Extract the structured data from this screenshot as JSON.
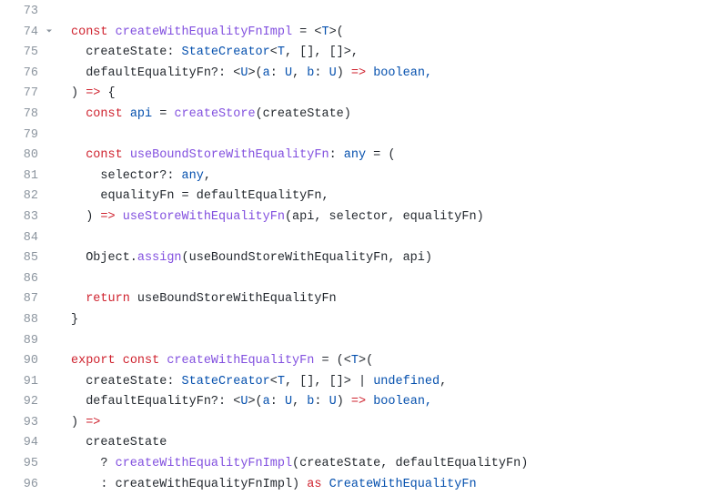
{
  "lines": [
    {
      "num": "73",
      "collapsible": false,
      "tokens": []
    },
    {
      "num": "74",
      "collapsible": true,
      "tokens": [
        {
          "t": "const ",
          "c": "tok-kw"
        },
        {
          "t": "createWithEqualityFnImpl",
          "c": "tok-fn"
        },
        {
          "t": " = <",
          "c": "tok-punc"
        },
        {
          "t": "T",
          "c": "tok-type"
        },
        {
          "t": ">(",
          "c": "tok-punc"
        }
      ]
    },
    {
      "num": "75",
      "collapsible": false,
      "tokens": [
        {
          "t": "  createState: ",
          "c": "tok-param"
        },
        {
          "t": "StateCreator",
          "c": "tok-type"
        },
        {
          "t": "<",
          "c": "tok-punc"
        },
        {
          "t": "T",
          "c": "tok-type"
        },
        {
          "t": ", [], []>,",
          "c": "tok-punc"
        }
      ]
    },
    {
      "num": "76",
      "collapsible": false,
      "tokens": [
        {
          "t": "  defaultEqualityFn?: <",
          "c": "tok-param"
        },
        {
          "t": "U",
          "c": "tok-type"
        },
        {
          "t": ">(",
          "c": "tok-punc"
        },
        {
          "t": "a",
          "c": "tok-var"
        },
        {
          "t": ": ",
          "c": "tok-punc"
        },
        {
          "t": "U",
          "c": "tok-type"
        },
        {
          "t": ", ",
          "c": "tok-punc"
        },
        {
          "t": "b",
          "c": "tok-var"
        },
        {
          "t": ": ",
          "c": "tok-punc"
        },
        {
          "t": "U",
          "c": "tok-type"
        },
        {
          "t": ") ",
          "c": "tok-punc"
        },
        {
          "t": "=>",
          "c": "tok-op"
        },
        {
          "t": " boolean,",
          "c": "tok-var"
        }
      ]
    },
    {
      "num": "77",
      "collapsible": false,
      "tokens": [
        {
          "t": ") ",
          "c": "tok-punc"
        },
        {
          "t": "=>",
          "c": "tok-op"
        },
        {
          "t": " {",
          "c": "tok-punc"
        }
      ]
    },
    {
      "num": "78",
      "collapsible": false,
      "tokens": [
        {
          "t": "  ",
          "c": "tok-plain"
        },
        {
          "t": "const ",
          "c": "tok-kw"
        },
        {
          "t": "api",
          "c": "tok-var"
        },
        {
          "t": " = ",
          "c": "tok-punc"
        },
        {
          "t": "createStore",
          "c": "tok-fn"
        },
        {
          "t": "(createState)",
          "c": "tok-punc"
        }
      ]
    },
    {
      "num": "79",
      "collapsible": false,
      "tokens": []
    },
    {
      "num": "80",
      "collapsible": false,
      "tokens": [
        {
          "t": "  ",
          "c": "tok-plain"
        },
        {
          "t": "const ",
          "c": "tok-kw"
        },
        {
          "t": "useBoundStoreWithEqualityFn",
          "c": "tok-fn"
        },
        {
          "t": ": ",
          "c": "tok-punc"
        },
        {
          "t": "any",
          "c": "tok-var"
        },
        {
          "t": " = (",
          "c": "tok-punc"
        }
      ]
    },
    {
      "num": "81",
      "collapsible": false,
      "tokens": [
        {
          "t": "    selector?: ",
          "c": "tok-param"
        },
        {
          "t": "any",
          "c": "tok-var"
        },
        {
          "t": ",",
          "c": "tok-punc"
        }
      ]
    },
    {
      "num": "82",
      "collapsible": false,
      "tokens": [
        {
          "t": "    equalityFn = defaultEqualityFn,",
          "c": "tok-param"
        }
      ]
    },
    {
      "num": "83",
      "collapsible": false,
      "tokens": [
        {
          "t": "  ) ",
          "c": "tok-punc"
        },
        {
          "t": "=>",
          "c": "tok-op"
        },
        {
          "t": " ",
          "c": "tok-punc"
        },
        {
          "t": "useStoreWithEqualityFn",
          "c": "tok-fn"
        },
        {
          "t": "(api, selector, equalityFn)",
          "c": "tok-punc"
        }
      ]
    },
    {
      "num": "84",
      "collapsible": false,
      "tokens": []
    },
    {
      "num": "85",
      "collapsible": false,
      "tokens": [
        {
          "t": "  Object.",
          "c": "tok-plain"
        },
        {
          "t": "assign",
          "c": "tok-fn"
        },
        {
          "t": "(useBoundStoreWithEqualityFn, api)",
          "c": "tok-punc"
        }
      ]
    },
    {
      "num": "86",
      "collapsible": false,
      "tokens": []
    },
    {
      "num": "87",
      "collapsible": false,
      "tokens": [
        {
          "t": "  ",
          "c": "tok-plain"
        },
        {
          "t": "return ",
          "c": "tok-kw"
        },
        {
          "t": "useBoundStoreWithEqualityFn",
          "c": "tok-plain"
        }
      ]
    },
    {
      "num": "88",
      "collapsible": false,
      "tokens": [
        {
          "t": "}",
          "c": "tok-punc"
        }
      ]
    },
    {
      "num": "89",
      "collapsible": false,
      "tokens": []
    },
    {
      "num": "90",
      "collapsible": false,
      "tokens": [
        {
          "t": "export ",
          "c": "tok-kw"
        },
        {
          "t": "const ",
          "c": "tok-kw"
        },
        {
          "t": "createWithEqualityFn",
          "c": "tok-fn"
        },
        {
          "t": " = (<",
          "c": "tok-punc"
        },
        {
          "t": "T",
          "c": "tok-type"
        },
        {
          "t": ">(",
          "c": "tok-punc"
        }
      ]
    },
    {
      "num": "91",
      "collapsible": false,
      "tokens": [
        {
          "t": "  createState: ",
          "c": "tok-param"
        },
        {
          "t": "StateCreator",
          "c": "tok-type"
        },
        {
          "t": "<",
          "c": "tok-punc"
        },
        {
          "t": "T",
          "c": "tok-type"
        },
        {
          "t": ", [], []> | ",
          "c": "tok-punc"
        },
        {
          "t": "undefined",
          "c": "tok-var"
        },
        {
          "t": ",",
          "c": "tok-punc"
        }
      ]
    },
    {
      "num": "92",
      "collapsible": false,
      "tokens": [
        {
          "t": "  defaultEqualityFn?: <",
          "c": "tok-param"
        },
        {
          "t": "U",
          "c": "tok-type"
        },
        {
          "t": ">(",
          "c": "tok-punc"
        },
        {
          "t": "a",
          "c": "tok-var"
        },
        {
          "t": ": ",
          "c": "tok-punc"
        },
        {
          "t": "U",
          "c": "tok-type"
        },
        {
          "t": ", ",
          "c": "tok-punc"
        },
        {
          "t": "b",
          "c": "tok-var"
        },
        {
          "t": ": ",
          "c": "tok-punc"
        },
        {
          "t": "U",
          "c": "tok-type"
        },
        {
          "t": ") ",
          "c": "tok-punc"
        },
        {
          "t": "=>",
          "c": "tok-op"
        },
        {
          "t": " boolean,",
          "c": "tok-var"
        }
      ]
    },
    {
      "num": "93",
      "collapsible": false,
      "tokens": [
        {
          "t": ") ",
          "c": "tok-punc"
        },
        {
          "t": "=>",
          "c": "tok-op"
        }
      ]
    },
    {
      "num": "94",
      "collapsible": false,
      "tokens": [
        {
          "t": "  createState",
          "c": "tok-plain"
        }
      ]
    },
    {
      "num": "95",
      "collapsible": false,
      "tokens": [
        {
          "t": "    ? ",
          "c": "tok-punc"
        },
        {
          "t": "createWithEqualityFnImpl",
          "c": "tok-fn"
        },
        {
          "t": "(createState, defaultEqualityFn)",
          "c": "tok-punc"
        }
      ]
    },
    {
      "num": "96",
      "collapsible": false,
      "tokens": [
        {
          "t": "    : createWithEqualityFnImpl) ",
          "c": "tok-punc"
        },
        {
          "t": "as ",
          "c": "tok-kw"
        },
        {
          "t": "CreateWithEqualityFn",
          "c": "tok-type"
        }
      ]
    }
  ]
}
